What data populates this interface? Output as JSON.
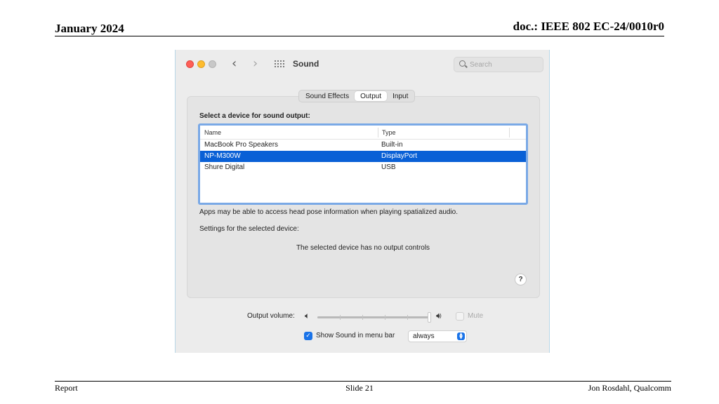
{
  "slide": {
    "date": "January 2024",
    "doc": "doc.: IEEE 802 EC-24/0010r0",
    "footer_left": "Report",
    "footer_center": "Slide 21",
    "footer_right": "Jon Rosdahl, Qualcomm"
  },
  "window": {
    "title": "Sound",
    "search_placeholder": "Search",
    "tabs": [
      {
        "label": "Sound Effects",
        "active": false
      },
      {
        "label": "Output",
        "active": true
      },
      {
        "label": "Input",
        "active": false
      }
    ],
    "device_heading": "Select a device for sound output:",
    "columns": {
      "name": "Name",
      "type": "Type"
    },
    "devices": [
      {
        "name": "MacBook Pro Speakers",
        "type": "Built-in",
        "selected": false
      },
      {
        "name": "NP-M300W",
        "type": "DisplayPort",
        "selected": true
      },
      {
        "name": "Shure Digital",
        "type": "USB",
        "selected": false
      }
    ],
    "spatial_note": "Apps may be able to access head pose information when playing spatialized audio.",
    "settings_label": "Settings for the selected device:",
    "no_controls": "The selected device has no output controls",
    "help_label": "?",
    "volume_label": "Output volume:",
    "volume_level": 1.0,
    "mute_label": "Mute",
    "mute_checked": false,
    "menu_bar_label": "Show Sound in menu bar",
    "menu_bar_checked": true,
    "menu_bar_option": "always"
  },
  "colors": {
    "selection": "#0960d6",
    "accent": "#1a73e8",
    "list_border": "#7aa9e6"
  },
  "icons": {
    "back": "chevron-left-icon",
    "forward": "chevron-right-icon",
    "grid": "show-all-grid-icon",
    "search": "search-icon",
    "speaker_low": "speaker-low-icon",
    "speaker_high": "speaker-high-icon",
    "check": "checkmark-icon",
    "popup": "up-down-chevron-icon"
  }
}
